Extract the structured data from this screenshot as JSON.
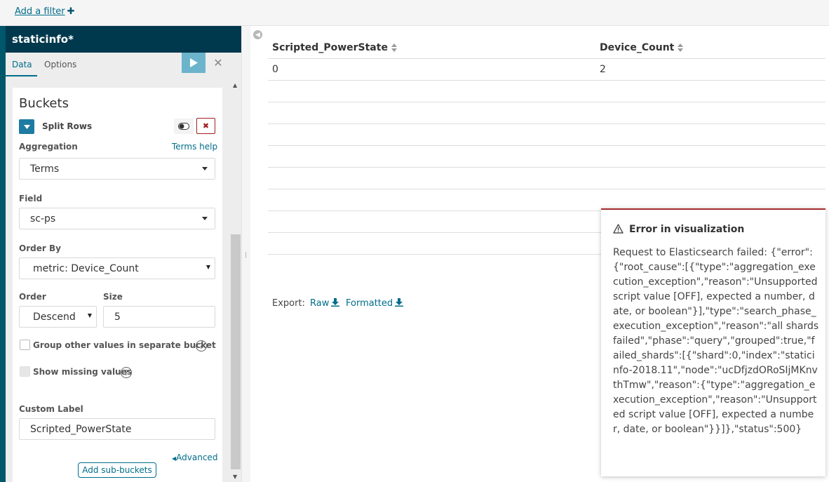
{
  "filterbar": {
    "add_filter_label": "Add a filter",
    "add_filter_icon": "plus-icon"
  },
  "sidebar": {
    "title": "staticinfo*",
    "tabs": [
      {
        "label": "Data",
        "active": true
      },
      {
        "label": "Options",
        "active": false
      }
    ],
    "apply_icon": "play-icon",
    "discard_icon": "close-icon"
  },
  "buckets": {
    "title": "Buckets",
    "split_label": "Split Rows",
    "aggregation": {
      "label": "Aggregation",
      "help_link": "Terms help",
      "value": "Terms"
    },
    "field": {
      "label": "Field",
      "value": "sc-ps"
    },
    "order_by": {
      "label": "Order By",
      "value": "metric: Device_Count"
    },
    "order": {
      "label": "Order",
      "value": "Descend"
    },
    "size": {
      "label": "Size",
      "value": "5"
    },
    "group_other": {
      "label": "Group other values in separate bucket",
      "checked": false
    },
    "show_missing": {
      "label": "Show missing values",
      "checked": false,
      "disabled": true
    },
    "custom_label": {
      "label": "Custom Label",
      "value": "Scripted_PowerState"
    },
    "advanced_link": "Advanced",
    "add_sub_buckets": "Add sub-buckets"
  },
  "table": {
    "columns": [
      "Scripted_PowerState",
      "Device_Count"
    ],
    "rows": [
      [
        "0",
        "2"
      ]
    ]
  },
  "export": {
    "label": "Export:",
    "raw": "Raw",
    "formatted": "Formatted"
  },
  "error": {
    "title": "Error in visualization",
    "message": "Request to Elasticsearch failed: {\"error\":{\"root_cause\":[{\"type\":\"aggregation_execution_exception\",\"reason\":\"Unsupported script value [OFF], expected a number, date, or boolean\"}],\"type\":\"search_phase_execution_exception\",\"reason\":\"all shards failed\",\"phase\":\"query\",\"grouped\":true,\"failed_shards\":[{\"shard\":0,\"index\":\"staticinfo-2018.11\",\"node\":\"ucDfjzdORoSIjMKnvthTmw\",\"reason\":{\"type\":\"aggregation_execution_exception\",\"reason\":\"Unsupported script value [OFF], expected a number, date, or boolean\"}}]},\"status\":500}"
  },
  "colors": {
    "brand_dark": "#00384d",
    "accent": "#006e8a",
    "danger": "#a42b2b"
  }
}
